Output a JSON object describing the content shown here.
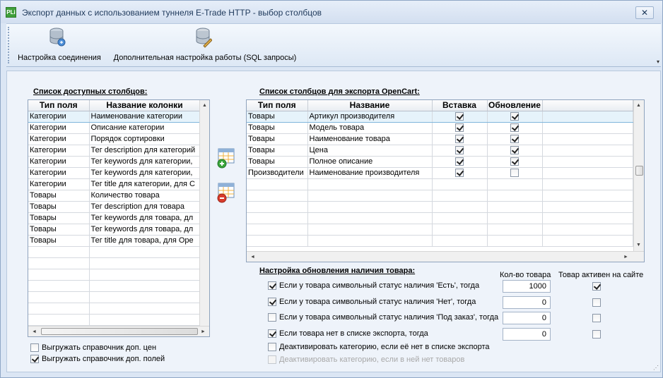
{
  "window": {
    "icon_text": "PLi",
    "title": "Экспорт данных с использованием туннеля E-Trade HTTP - выбор столбцов",
    "close_glyph": "✕"
  },
  "toolbar": {
    "connection_label": "Настройка соединения",
    "sql_label": "Дополнительная настройка работы (SQL запросы)",
    "more_glyph": "▾"
  },
  "available": {
    "title": "Список доступных столбцов:",
    "headers": [
      "Тип поля",
      "Название колонки"
    ],
    "rows": [
      [
        "Категории",
        "Наименование категории"
      ],
      [
        "Категории",
        "Описание категории"
      ],
      [
        "Категории",
        "Порядок сортировки"
      ],
      [
        "Категории",
        "Тег description для категорий"
      ],
      [
        "Категории",
        "Тег keywords для категории,"
      ],
      [
        "Категории",
        "Тег keywords для категории,"
      ],
      [
        "Категории",
        "Тег title для категории, для С"
      ],
      [
        "Товары",
        "Количество товара"
      ],
      [
        "Товары",
        "Тег description для товара"
      ],
      [
        "Товары",
        "Тег keywords для товара, дл"
      ],
      [
        "Товары",
        "Тег keywords для товара, дл"
      ],
      [
        "Товары",
        "Тег title для товара, для Ope"
      ]
    ],
    "empty_rows": 7
  },
  "export": {
    "title": "Список столбцов для экспорта OpenCart:",
    "headers": [
      "Тип поля",
      "Название",
      "Вставка",
      "Обновление"
    ],
    "rows": [
      {
        "type": "Товары",
        "name": "Артикул производителя",
        "insert": true,
        "update": true
      },
      {
        "type": "Товары",
        "name": "Модель товара",
        "insert": true,
        "update": true
      },
      {
        "type": "Товары",
        "name": "Наименование товара",
        "insert": true,
        "update": true
      },
      {
        "type": "Товары",
        "name": "Цена",
        "insert": true,
        "update": true
      },
      {
        "type": "Товары",
        "name": "Полное описание",
        "insert": true,
        "update": true
      },
      {
        "type": "Производители",
        "name": "Наименование производителя",
        "insert": true,
        "update": false
      }
    ],
    "empty_rows": 6
  },
  "bottom_left": {
    "opt1": {
      "label": "Выгружать справочник доп. цен",
      "checked": false
    },
    "opt2": {
      "label": "Выгружать справочник доп. полей",
      "checked": true
    }
  },
  "stock": {
    "title": "Настройка обновления наличия товара:",
    "qty_header": "Кол-во товара",
    "active_header": "Товар активен на сайте",
    "rows": [
      {
        "label": "Если у товара символьный статус наличия 'Есть', тогда",
        "checked": true,
        "qty": "1000",
        "active": true
      },
      {
        "label": "Если у товара символьный статус наличия 'Нет', тогда",
        "checked": true,
        "qty": "0",
        "active": false
      },
      {
        "label": "Если у товара символьный статус наличия 'Под заказ', тогда",
        "checked": false,
        "qty": "0",
        "active": false
      },
      {
        "label": "Если товара нет в списке экспорта, тогда",
        "checked": true,
        "qty": "0",
        "active": false
      }
    ],
    "deact1": {
      "label": "Деактивировать категорию, если её нет в списке экспорта",
      "checked": false
    },
    "deact2": {
      "label": "Деактивировать категорию, если в ней нет товаров",
      "checked": false
    }
  },
  "scroll": {
    "up": "▲",
    "down": "▼",
    "left": "◄",
    "right": "►"
  },
  "colors": {
    "title_text": "#1e395b",
    "selection": "#e6f3fb",
    "add_icon": "#3aa53a",
    "remove_icon": "#d93b2b"
  }
}
